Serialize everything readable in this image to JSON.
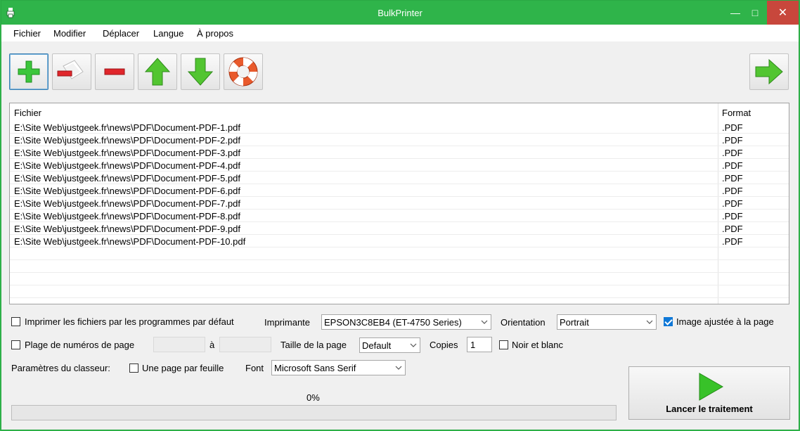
{
  "window": {
    "title": "BulkPrinter",
    "controls": {
      "minimize": "—",
      "maximize": "□",
      "close": "✕"
    },
    "accent_color": "#2fb44a"
  },
  "menu": [
    "Fichier",
    "Modifier",
    "Déplacer",
    "Langue",
    "À propos"
  ],
  "toolbar": [
    {
      "name": "add-files",
      "icon": "plus-icon"
    },
    {
      "name": "remove-selected",
      "icon": "remove-document-icon"
    },
    {
      "name": "remove",
      "icon": "minus-icon"
    },
    {
      "name": "move-up",
      "icon": "arrow-up-icon"
    },
    {
      "name": "move-down",
      "icon": "arrow-down-icon"
    },
    {
      "name": "help",
      "icon": "lifebuoy-icon"
    },
    {
      "name": "next",
      "icon": "arrow-right-icon"
    }
  ],
  "file_list": {
    "columns": [
      "Fichier",
      "Format"
    ],
    "rows": [
      [
        "E:\\Site Web\\justgeek.fr\\news\\PDF\\Document-PDF-1.pdf",
        ".PDF"
      ],
      [
        "E:\\Site Web\\justgeek.fr\\news\\PDF\\Document-PDF-2.pdf",
        ".PDF"
      ],
      [
        "E:\\Site Web\\justgeek.fr\\news\\PDF\\Document-PDF-3.pdf",
        ".PDF"
      ],
      [
        "E:\\Site Web\\justgeek.fr\\news\\PDF\\Document-PDF-4.pdf",
        ".PDF"
      ],
      [
        "E:\\Site Web\\justgeek.fr\\news\\PDF\\Document-PDF-5.pdf",
        ".PDF"
      ],
      [
        "E:\\Site Web\\justgeek.fr\\news\\PDF\\Document-PDF-6.pdf",
        ".PDF"
      ],
      [
        "E:\\Site Web\\justgeek.fr\\news\\PDF\\Document-PDF-7.pdf",
        ".PDF"
      ],
      [
        "E:\\Site Web\\justgeek.fr\\news\\PDF\\Document-PDF-8.pdf",
        ".PDF"
      ],
      [
        "E:\\Site Web\\justgeek.fr\\news\\PDF\\Document-PDF-9.pdf",
        ".PDF"
      ],
      [
        "E:\\Site Web\\justgeek.fr\\news\\PDF\\Document-PDF-10.pdf",
        ".PDF"
      ]
    ]
  },
  "options": {
    "default_programs": {
      "label": "Imprimer les fichiers par les programmes par défaut",
      "checked": false
    },
    "printer": {
      "label": "Imprimante",
      "value": "EPSON3C8EB4 (ET-4750 Series)"
    },
    "orientation": {
      "label": "Orientation",
      "value": "Portrait"
    },
    "fit_image": {
      "label": "Image ajustée à la page",
      "checked": true
    },
    "page_range": {
      "label": "Plage de numéros de page",
      "checked": false,
      "to_label": "à",
      "from": "",
      "to": ""
    },
    "page_size": {
      "label": "Taille de la page",
      "value": "Default"
    },
    "copies": {
      "label": "Copies",
      "value": "1"
    },
    "grayscale": {
      "label": "Noir et blanc",
      "checked": false
    },
    "workbook": {
      "label": "Paramètres du classeur:"
    },
    "one_page_per_sheet": {
      "label": "Une page par feuille",
      "checked": false
    },
    "font": {
      "label": "Font",
      "value": "Microsoft Sans Serif"
    }
  },
  "progress": {
    "value": 0,
    "text": "0%"
  },
  "launch": {
    "label": "Lancer le traitement",
    "icon": "play-icon"
  }
}
